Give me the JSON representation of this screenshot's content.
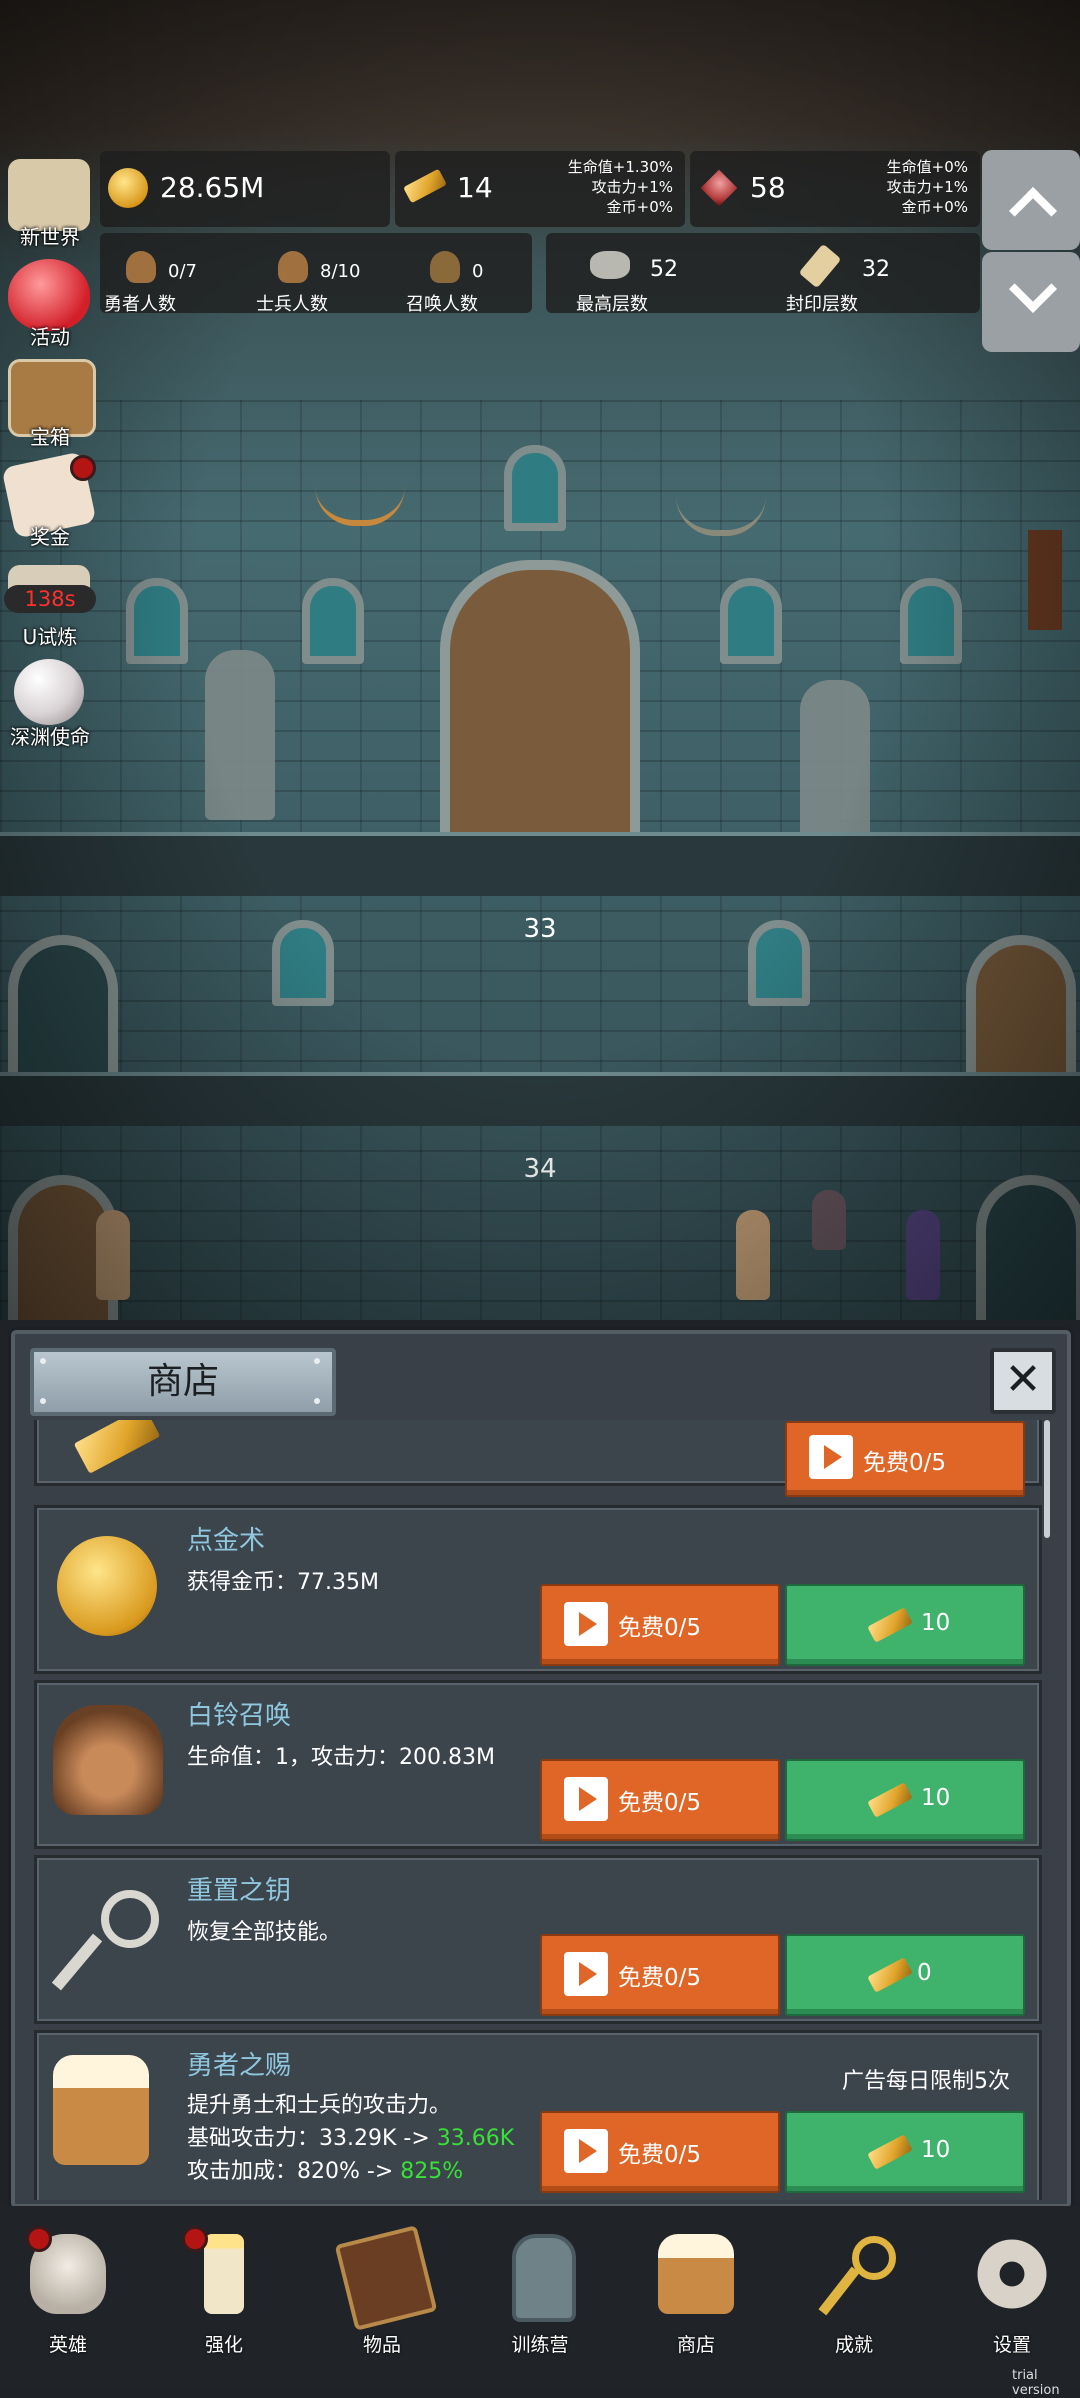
{
  "resources": {
    "gold": {
      "value": "28.65M",
      "icon": "gold-coin-icon"
    },
    "gold_bar": {
      "value": "14",
      "bonus": [
        "生命值+1.30%",
        "攻击力+1%",
        "金币+0%"
      ],
      "icon": "gold-bar-icon"
    },
    "gem": {
      "value": "58",
      "bonus": [
        "生命值+0%",
        "攻击力+1%",
        "金币+0%"
      ],
      "icon": "red-gem-icon"
    }
  },
  "counts": [
    {
      "value": "0/7",
      "label": "勇者人数",
      "icon": "hero-head-icon"
    },
    {
      "value": "8/10",
      "label": "士兵人数",
      "icon": "soldier-head-icon"
    },
    {
      "value": "0",
      "label": "召唤人数",
      "icon": "summon-head-icon"
    },
    {
      "value": "52",
      "label": "最高层数",
      "icon": "stone-icon"
    },
    {
      "value": "32",
      "label": "封印层数",
      "icon": "scroll-icon"
    }
  ],
  "left_menu": [
    {
      "label": "新世界",
      "icon": "map-icon"
    },
    {
      "label": "活动",
      "icon": "heart-icon"
    },
    {
      "label": "宝箱",
      "icon": "chest-icon"
    },
    {
      "label": "奖金",
      "icon": "letter-icon"
    },
    {
      "label": "U试炼",
      "timer": "138s",
      "icon": "trial-icon"
    },
    {
      "label": "深渊使命",
      "icon": "pearl-icon"
    }
  ],
  "floors": [
    "33",
    "34"
  ],
  "shop": {
    "title": "商店",
    "close_icon": "close-icon",
    "partial_free": "免费0/5",
    "items": [
      {
        "title": "点金术",
        "desc": "获得金币：77.35M",
        "free": "免费0/5",
        "price": "10",
        "icon": "gold-coin-icon"
      },
      {
        "title": "白铃召唤",
        "desc": "生命值：1，攻击力：200.83M",
        "free": "免费0/5",
        "price": "10",
        "icon": "girl-portrait-icon"
      },
      {
        "title": "重置之钥",
        "desc": "恢复全部技能。",
        "free": "免费0/5",
        "price": "0",
        "icon": "key-icon"
      },
      {
        "title": "勇者之赐",
        "desc1": "提升勇士和士兵的攻击力。",
        "desc2a": "基础攻击力：33.29K -> ",
        "desc2b": "33.66K",
        "desc3a": "攻击加成：820% -> ",
        "desc3b": "825%",
        "limit": "广告每日限制5次",
        "free": "免费0/5",
        "price": "10",
        "icon": "beer-mug-icon"
      }
    ]
  },
  "nav": [
    {
      "label": "英雄",
      "icon": "skull-icon"
    },
    {
      "label": "强化",
      "icon": "candle-icon"
    },
    {
      "label": "物品",
      "icon": "book-icon"
    },
    {
      "label": "训练营",
      "icon": "lantern-icon"
    },
    {
      "label": "商店",
      "icon": "beer-mug-icon"
    },
    {
      "label": "成就",
      "icon": "key-icon"
    },
    {
      "label": "设置",
      "icon": "gear-icon"
    }
  ],
  "watermark": "trial version",
  "colors": {
    "accent_orange": "#e06628",
    "accent_green": "#3fb36b",
    "highlight": "#38e038",
    "title_blue": "#8fc7df"
  }
}
